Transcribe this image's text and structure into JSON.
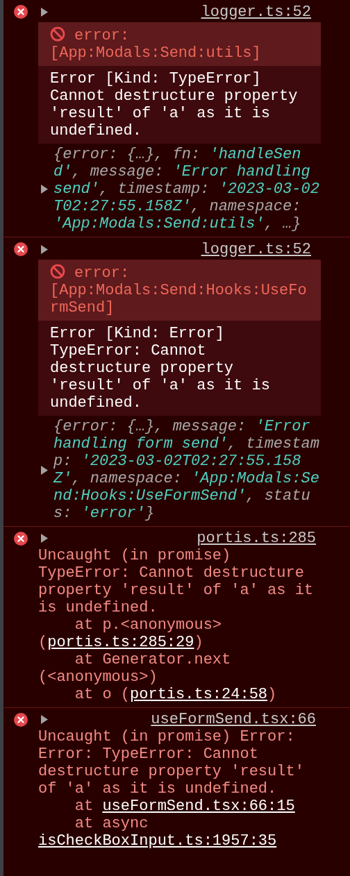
{
  "entries": [
    {
      "kind": "log",
      "expanded": false,
      "source": "logger.ts:52",
      "title": "error:",
      "namespace": "[App:Modals:Send:utils]",
      "body": "Error [Kind: TypeError]\nCannot destructure property 'result' of 'a' as it is undefined.",
      "preview": {
        "expanded": false,
        "parts": [
          {
            "kind": "key",
            "text": "{error: {…}, fn: "
          },
          {
            "kind": "string",
            "text": "'handleSend'"
          },
          {
            "kind": "key",
            "text": ", message: "
          },
          {
            "kind": "string",
            "text": "'Error handling send'"
          },
          {
            "kind": "key",
            "text": ", timestamp: "
          },
          {
            "kind": "string",
            "text": "'2023-03-02T02:27:55.158Z'"
          },
          {
            "kind": "key",
            "text": ", namespace: "
          },
          {
            "kind": "string",
            "text": "'App:Modals:Send:utils'"
          },
          {
            "kind": "key",
            "text": ", …}"
          }
        ]
      }
    },
    {
      "kind": "log",
      "expanded": false,
      "source": "logger.ts:52",
      "title": "error:",
      "namespace": "[App:Modals:Send:Hooks:UseFormSend]",
      "body": "Error [Kind: Error]\nTypeError: Cannot destructure property 'result' of 'a' as it is undefined.",
      "preview": {
        "expanded": false,
        "parts": [
          {
            "kind": "key",
            "text": "{error: {…}, message: "
          },
          {
            "kind": "string",
            "text": "'Error handling form send'"
          },
          {
            "kind": "key",
            "text": ", timestamp: "
          },
          {
            "kind": "string",
            "text": "'2023-03-02T02:27:55.158Z'"
          },
          {
            "kind": "key",
            "text": ", namespace: "
          },
          {
            "kind": "string",
            "text": "'App:Modals:Send:Hooks:UseFormSend'"
          },
          {
            "kind": "key",
            "text": ", status: "
          },
          {
            "kind": "string",
            "text": "'error'"
          },
          {
            "kind": "key",
            "text": "}"
          }
        ]
      }
    },
    {
      "kind": "uncaught",
      "expanded": false,
      "source": "portis.ts:285",
      "message": [
        {
          "kind": "plain",
          "text": "Uncaught (in promise) TypeError: Cannot destructure property 'result' of 'a' as it is undefined.\n    at p.<anonymous> ("
        },
        {
          "kind": "link",
          "text": "portis.ts:285:29"
        },
        {
          "kind": "plain",
          "text": ")\n    at Generator.next (<anonymous>)\n    at o ("
        },
        {
          "kind": "link",
          "text": "portis.ts:24:58"
        },
        {
          "kind": "plain",
          "text": ")"
        }
      ]
    },
    {
      "kind": "uncaught",
      "expanded": false,
      "source": "useFormSend.tsx:66",
      "message": [
        {
          "kind": "plain",
          "text": "Uncaught (in promise) Error: Error: TypeError: Cannot destructure property 'result' of 'a' as it is undefined.\n    at "
        },
        {
          "kind": "link",
          "text": "useFormSend.tsx:66:15"
        },
        {
          "kind": "plain",
          "text": "\n    at async "
        },
        {
          "kind": "link",
          "text": "isCheckBoxInput.ts:1957:35"
        }
      ]
    }
  ]
}
